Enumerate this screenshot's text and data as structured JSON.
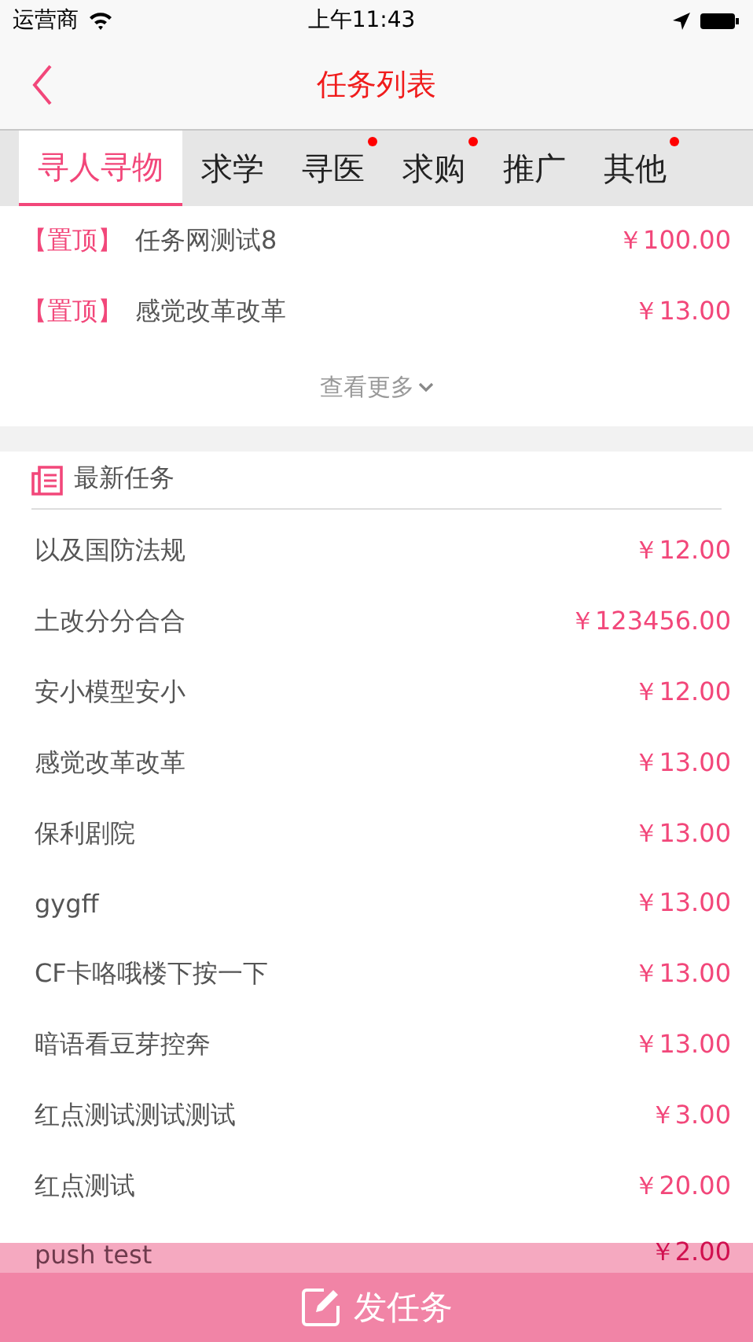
{
  "status_bar": {
    "carrier": "运营商",
    "time": "上午11:43"
  },
  "nav": {
    "title": "任务列表"
  },
  "tabs": [
    {
      "label": "寻人寻物",
      "selected": true,
      "badge": false
    },
    {
      "label": "求学",
      "selected": false,
      "badge": false
    },
    {
      "label": "寻医",
      "selected": false,
      "badge": true
    },
    {
      "label": "求购",
      "selected": false,
      "badge": true
    },
    {
      "label": "推广",
      "selected": false,
      "badge": false
    },
    {
      "label": "其他",
      "selected": false,
      "badge": true
    }
  ],
  "pinned": [
    {
      "tag": "【置顶】",
      "title": "任务网测试8",
      "price": "￥100.00"
    },
    {
      "tag": "【置顶】",
      "title": "感觉改革改革",
      "price": "￥13.00"
    }
  ],
  "more": "查看更多",
  "section_title": "最新任务",
  "tasks": [
    {
      "title": "以及国防法规",
      "price": "￥12.00"
    },
    {
      "title": "土改分分合合",
      "price": "￥123456.00"
    },
    {
      "title": "安小模型安小",
      "price": "￥12.00"
    },
    {
      "title": "感觉改革改革",
      "price": "￥13.00"
    },
    {
      "title": "保利剧院",
      "price": "￥13.00"
    },
    {
      "title": "gygff",
      "price": "￥13.00"
    },
    {
      "title": "CF卡咯哦楼下按一下",
      "price": "￥13.00"
    },
    {
      "title": "暗语看豆芽控奔",
      "price": "￥13.00"
    },
    {
      "title": "红点测试测试测试",
      "price": "￥3.00"
    },
    {
      "title": "红点测试",
      "price": "￥20.00"
    },
    {
      "title": "push test",
      "price": "￥2.00"
    }
  ],
  "post_button": "发任务"
}
